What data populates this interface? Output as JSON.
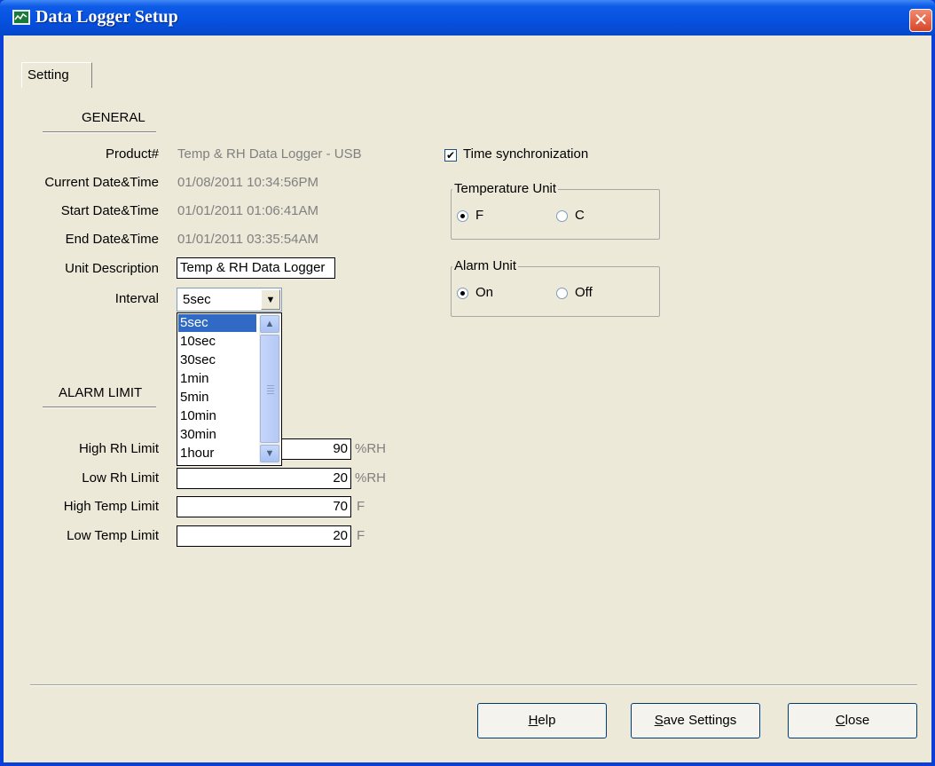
{
  "window": {
    "title": "Data Logger Setup",
    "close_glyph": "✕"
  },
  "tabs": [
    {
      "label": "Setting"
    }
  ],
  "general": {
    "section_title": "GENERAL",
    "rows": [
      {
        "label": "Product#",
        "value": "Temp & RH Data Logger - USB"
      },
      {
        "label": "Current Date&Time",
        "value": "01/08/2011 10:34:56PM"
      },
      {
        "label": "Start Date&Time",
        "value": "01/01/2011 01:06:41AM"
      },
      {
        "label": "End Date&Time",
        "value": "01/01/2011 03:35:54AM"
      }
    ],
    "unit_description": {
      "label": "Unit Description",
      "value": "Temp & RH Data Logger"
    },
    "interval": {
      "label": "Interval",
      "selected": "5sec",
      "options": [
        "5sec",
        "10sec",
        "30sec",
        "1min",
        "5min",
        "10min",
        "30min",
        "1hour"
      ]
    }
  },
  "alarm_limit": {
    "section_title": "ALARM LIMIT",
    "rows": [
      {
        "label": "High Rh Limit",
        "value": "90",
        "unit": "%RH"
      },
      {
        "label": "Low Rh Limit",
        "value": "20",
        "unit": "%RH"
      },
      {
        "label": "High Temp Limit",
        "value": "70",
        "unit": "F"
      },
      {
        "label": "Low Temp Limit",
        "value": "20",
        "unit": "F"
      }
    ]
  },
  "time_sync": {
    "label": "Time synchronization",
    "checked": true
  },
  "temperature_unit": {
    "title": "Temperature Unit",
    "options": [
      {
        "label": "F",
        "selected": true
      },
      {
        "label": "C",
        "selected": false
      }
    ]
  },
  "alarm_unit": {
    "title": "Alarm Unit",
    "options": [
      {
        "label": "On",
        "selected": true
      },
      {
        "label": "Off",
        "selected": false
      }
    ]
  },
  "buttons": {
    "help": {
      "mnemonic": "H",
      "rest": "elp"
    },
    "save": {
      "mnemonic": "S",
      "rest": "ave Settings"
    },
    "close": {
      "mnemonic": "C",
      "rest": "lose"
    }
  }
}
